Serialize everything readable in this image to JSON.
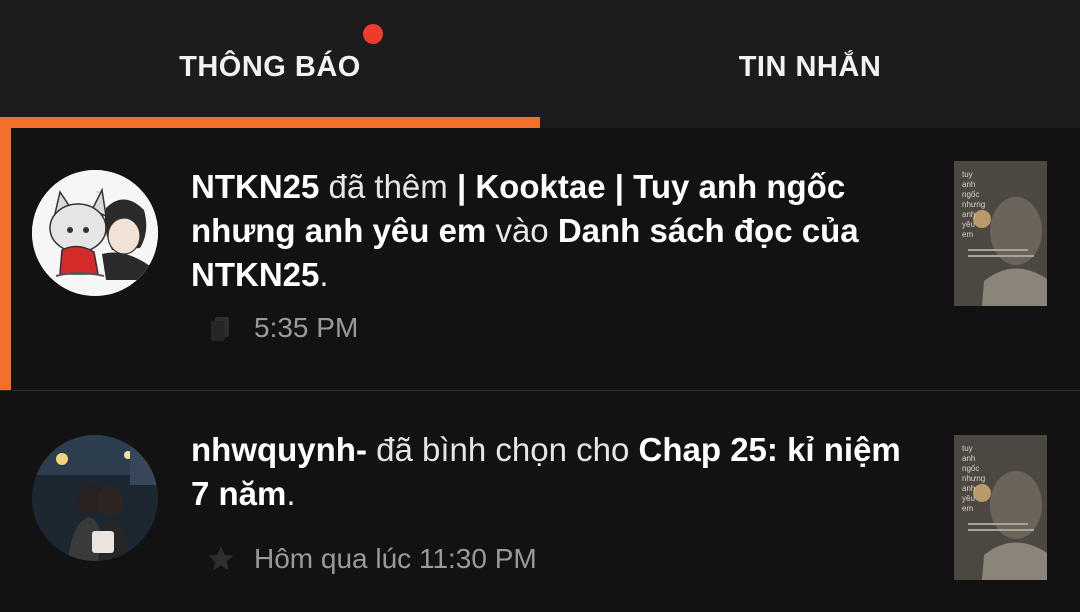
{
  "tabs": {
    "notifications": {
      "label": "THÔNG BÁO",
      "has_unread_dot": true
    },
    "messages": {
      "label": "TIN NHẮN"
    }
  },
  "colors": {
    "accent": "#f36f2c",
    "unread_dot": "#ee3b2b",
    "background": "#121212",
    "tabbar": "#1c1c1c",
    "meta_text": "#9a9a9a"
  },
  "notifications": [
    {
      "actor": "NTKN25",
      "action": "đã thêm",
      "object": "| Kooktae | Tuy anh ngốc nhưng anh yêu em",
      "connector": "vào",
      "target": "Danh sách đọc của NTKN25",
      "end": ".",
      "time": "5:35 PM",
      "icon": "reading-list-icon",
      "unread": true
    },
    {
      "actor": "nhwquynh-",
      "action": "đã bình chọn cho",
      "object": "Chap 25: kỉ niệm 7 năm",
      "end": ".",
      "time": "Hôm qua lúc 11:30 PM",
      "icon": "star-icon",
      "unread": false
    }
  ]
}
